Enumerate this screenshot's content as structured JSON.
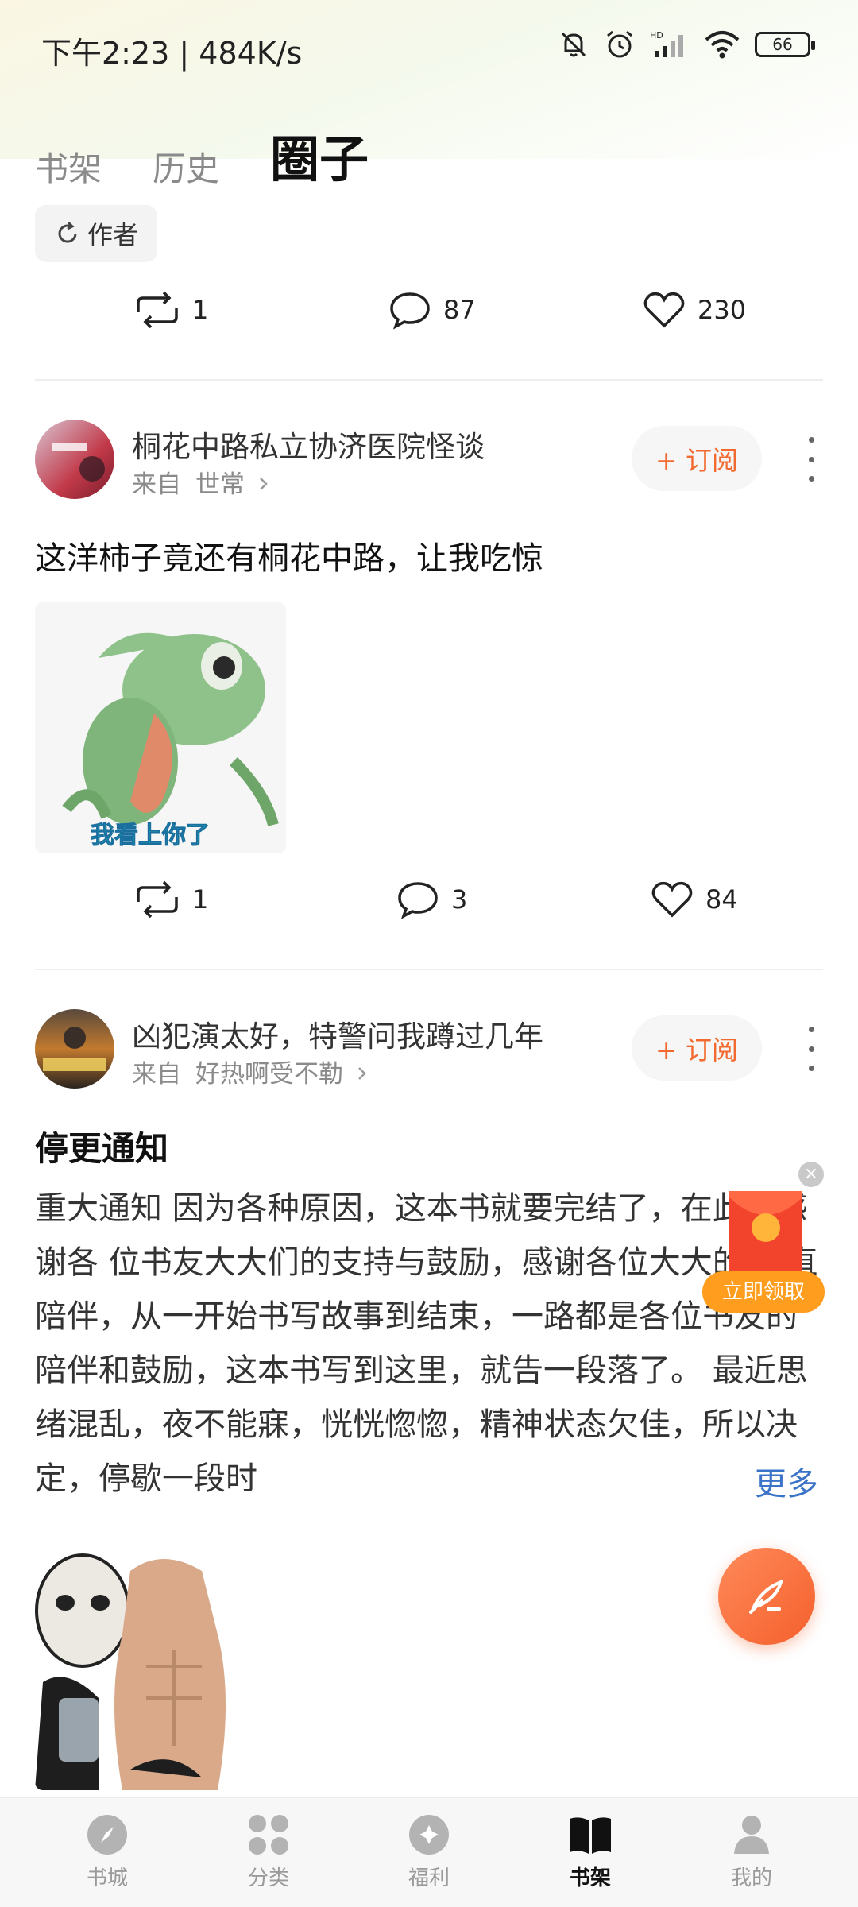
{
  "status_bar": {
    "time": "下午2:23 | 484K/s",
    "battery": "66"
  },
  "tabs": [
    {
      "label": "书架",
      "active": false
    },
    {
      "label": "历史",
      "active": false
    },
    {
      "label": "圈子",
      "active": true
    }
  ],
  "filter": {
    "label": "作者"
  },
  "posts": [
    {
      "stats": {
        "reposts": "1",
        "comments": "87",
        "likes": "230"
      }
    },
    {
      "book_title": "桐花中路私立协济医院怪谈",
      "source_prefix": "来自",
      "source_name": "世常",
      "subscribe_label": "+ 订阅",
      "text": "这洋柿子竟还有桐花中路，让我吃惊",
      "image_caption": "我看上你了",
      "stats": {
        "reposts": "1",
        "comments": "3",
        "likes": "84"
      }
    },
    {
      "book_title": "凶犯演太好，特警问我蹲过几年",
      "source_prefix": "来自",
      "source_name": "好热啊受不勒",
      "subscribe_label": "+ 订阅",
      "title": "停更通知",
      "body": "重大通知 因为各种原因，这本书就要完结了，在此，感谢各 位书友大大们的支持与鼓励，感谢各位大大的 一直陪伴，从一开始书写故事到结束，一路都是各位书友的陪伴和鼓励，这本书写到这里，就告一段落了。 最近思绪混乱，夜不能寐，恍恍惚惚，精神状态欠佳，所以决定，停歇一段时",
      "more_label": "更多"
    }
  ],
  "red_packet": {
    "button_label": "立即领取"
  },
  "bottom_nav": [
    {
      "label": "书城",
      "icon": "compass-icon",
      "active": false
    },
    {
      "label": "分类",
      "icon": "grid-icon",
      "active": false
    },
    {
      "label": "福利",
      "icon": "gift-icon",
      "active": false
    },
    {
      "label": "书架",
      "icon": "book-icon",
      "active": true
    },
    {
      "label": "我的",
      "icon": "person-icon",
      "active": false
    }
  ],
  "colors": {
    "accent": "#f26a2f",
    "link": "#3a73c8",
    "fab": "#f4602c"
  }
}
